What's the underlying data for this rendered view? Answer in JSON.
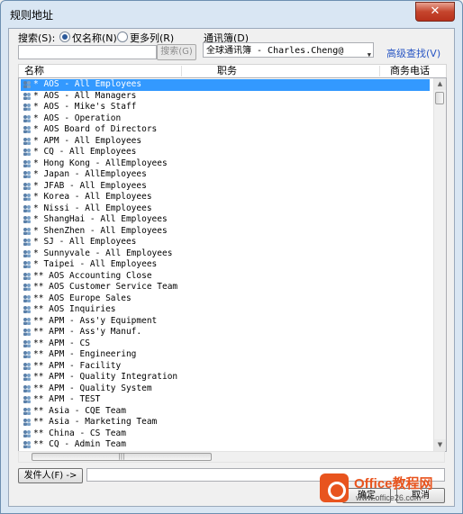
{
  "window": {
    "title": "规则地址",
    "close_label": "✕"
  },
  "search": {
    "label": "搜索(S):",
    "option_name_only": "仅名称(N)",
    "option_more_columns": "更多列(R)",
    "selected_option": "name_only",
    "input_value": "",
    "button_label": "搜索(G)"
  },
  "address_book": {
    "label": "通讯簿(D)",
    "selected_value": "全球通讯簿 - Charles.Cheng@",
    "advanced_link": "高级查找(V)"
  },
  "columns": {
    "name": "名称",
    "title": "职务",
    "business_phone": "商务电话"
  },
  "rows": [
    {
      "name": "* AOS - All Employees",
      "selected": true
    },
    {
      "name": "* AOS - All Managers"
    },
    {
      "name": "* AOS - Mike's Staff"
    },
    {
      "name": "* AOS - Operation"
    },
    {
      "name": "* AOS Board of Directors"
    },
    {
      "name": "* APM - All Employees"
    },
    {
      "name": "* CQ - All Employees"
    },
    {
      "name": "* Hong Kong - AllEmployees"
    },
    {
      "name": "* Japan - AllEmployees"
    },
    {
      "name": "* JFAB - All Employees"
    },
    {
      "name": "* Korea - All Employees"
    },
    {
      "name": "* Nissi - All Employees"
    },
    {
      "name": "* ShangHai - All Employees"
    },
    {
      "name": "* ShenZhen - All Employees"
    },
    {
      "name": "* SJ - All Employees"
    },
    {
      "name": "* Sunnyvale - All Employees"
    },
    {
      "name": "* Taipei - All Employees"
    },
    {
      "name": "** AOS Accounting Close"
    },
    {
      "name": "** AOS Customer Service Team"
    },
    {
      "name": "** AOS Europe Sales"
    },
    {
      "name": "** AOS Inquiries"
    },
    {
      "name": "** APM - Ass'y Equipment"
    },
    {
      "name": "** APM - Ass'y Manuf."
    },
    {
      "name": "** APM - CS"
    },
    {
      "name": "** APM - Engineering"
    },
    {
      "name": "** APM - Facility"
    },
    {
      "name": "** APM - Quality Integration"
    },
    {
      "name": "** APM - Quality System"
    },
    {
      "name": "** APM - TEST"
    },
    {
      "name": "** Asia - CQE Team"
    },
    {
      "name": "** Asia - Marketing Team"
    },
    {
      "name": "** China - CS Team"
    },
    {
      "name": "** CQ - Admin Team"
    }
  ],
  "sender": {
    "button_label": "发件人(F) ->",
    "value": ""
  },
  "footer": {
    "ok_label": "确定",
    "cancel_label": "取消"
  },
  "watermark": {
    "brand": "Office教程网",
    "url": "www.office26.com"
  },
  "colors": {
    "selection": "#3399ff",
    "link": "#2a57c4",
    "brand": "#e8541e"
  }
}
